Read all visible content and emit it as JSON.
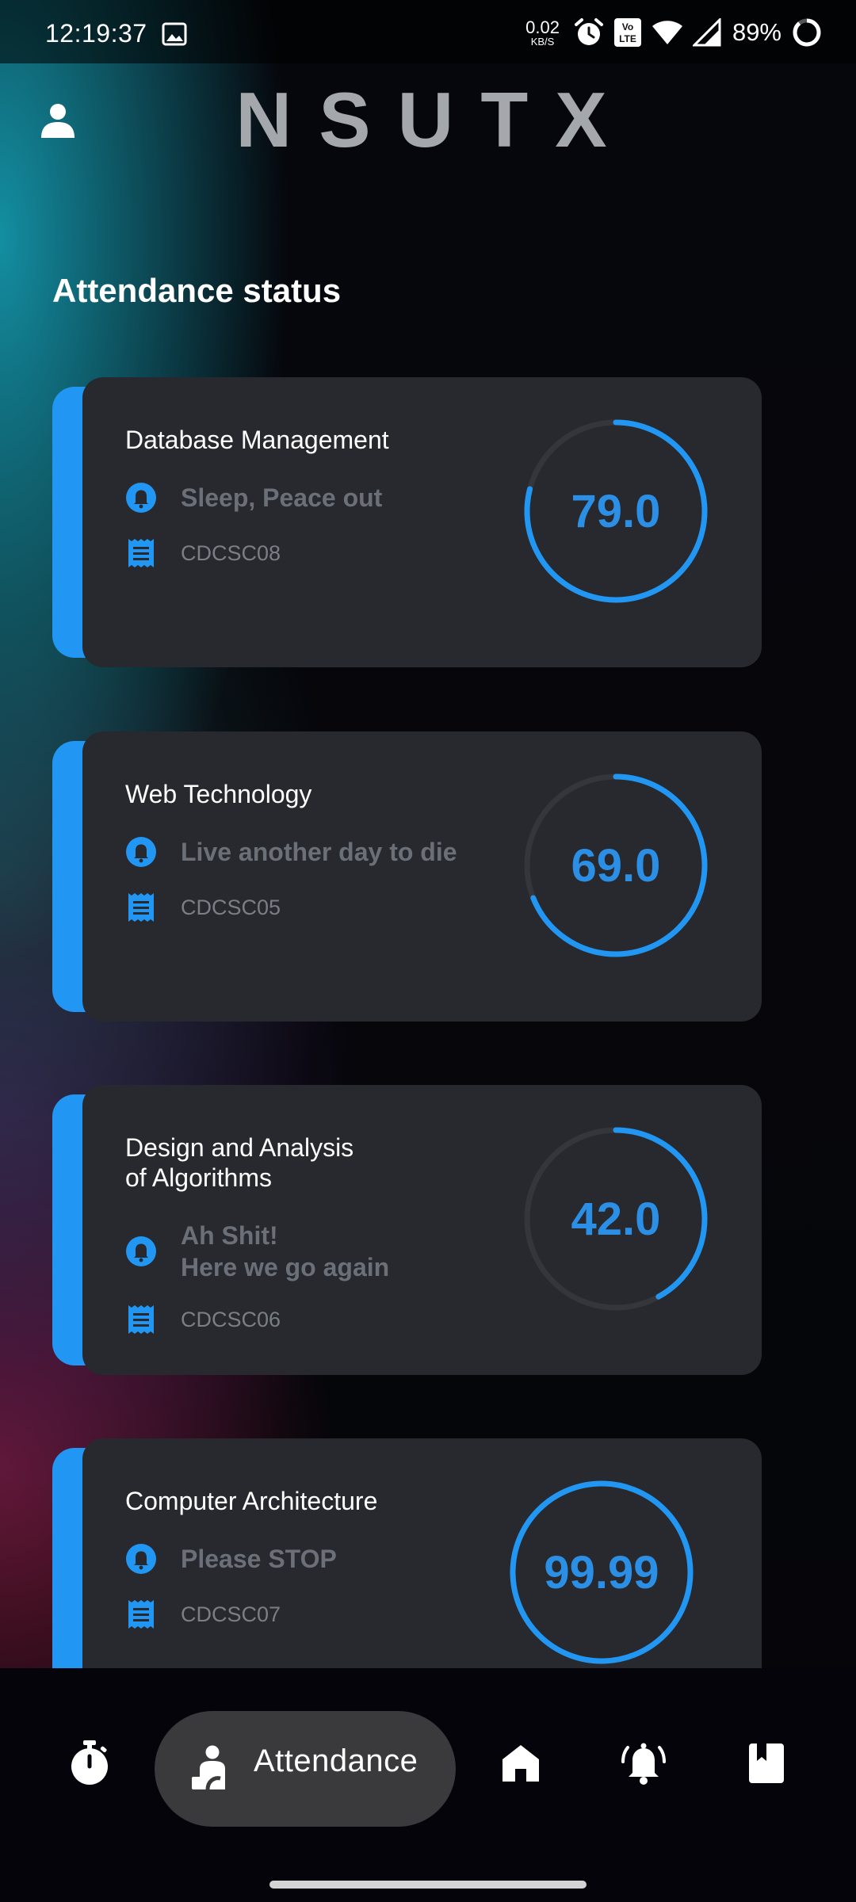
{
  "status_bar": {
    "time": "12:19:37",
    "net_speed_value": "0.02",
    "net_speed_unit": "KB/S",
    "battery": "89%",
    "icons": [
      "image-icon",
      "alarm-icon",
      "volte-icon",
      "wifi-icon",
      "signal-icon",
      "battery-ring-icon"
    ]
  },
  "header": {
    "app_title": "NSUTX",
    "profile_icon": "person-icon"
  },
  "section_title": "Attendance status",
  "cards": [
    {
      "title": "Database Management",
      "status": "Sleep, Peace out",
      "code": "CDCSC08",
      "percent_label": "79.0",
      "percent": 79.0
    },
    {
      "title": "Web Technology",
      "status": "Live another day to die",
      "code": "CDCSC05",
      "percent_label": "69.0",
      "percent": 69.0
    },
    {
      "title": "Design and Analysis\nof Algorithms",
      "status": "Ah Shit!\nHere we go again",
      "code": "CDCSC06",
      "percent_label": "42.0",
      "percent": 42.0
    },
    {
      "title": "Computer Architecture",
      "status": "Please STOP",
      "code": "CDCSC07",
      "percent_label": "99.99",
      "percent": 99.99
    }
  ],
  "bottom_nav": {
    "items": [
      {
        "name": "timer",
        "icon": "stopwatch-icon"
      },
      {
        "name": "attendance",
        "icon": "person-attendance-icon",
        "label": "Attendance",
        "active": true
      },
      {
        "name": "home",
        "icon": "home-icon"
      },
      {
        "name": "notifications",
        "icon": "bell-ring-icon"
      },
      {
        "name": "library",
        "icon": "book-icon"
      }
    ]
  },
  "colors": {
    "accent": "#2196f3",
    "card_bg": "#27292e",
    "muted_text": "#6b7078",
    "nav_pill": "#3a3a3c"
  }
}
